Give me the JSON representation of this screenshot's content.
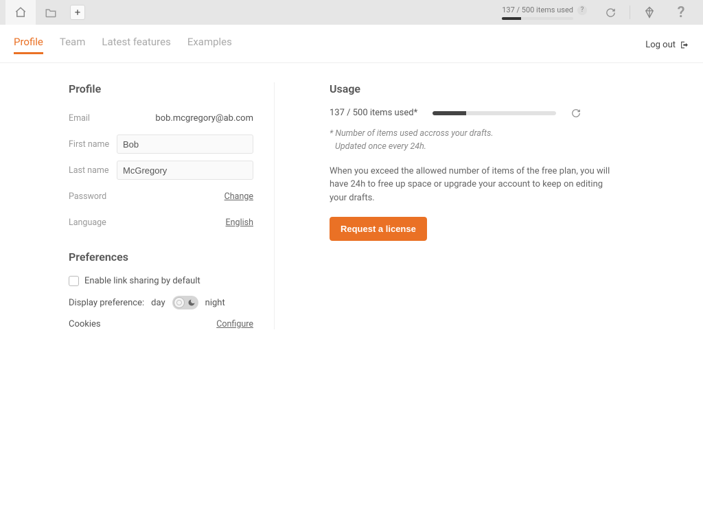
{
  "toolbar": {
    "usage_label": "137 / 500 items used",
    "usage_pct": 27
  },
  "nav": {
    "tabs": [
      "Profile",
      "Team",
      "Latest features",
      "Examples"
    ],
    "active_index": 0,
    "logout_label": "Log out"
  },
  "profile": {
    "heading": "Profile",
    "email_label": "Email",
    "email_value": "bob.mcgregory@ab.com",
    "firstname_label": "First name",
    "firstname_value": "Bob",
    "lastname_label": "Last name",
    "lastname_value": "McGregory",
    "password_label": "Password",
    "change_label": "Change",
    "language_label": "Language",
    "language_value": "English"
  },
  "preferences": {
    "heading": "Preferences",
    "link_sharing_label": "Enable link sharing by default",
    "display_pref_label": "Display preference:",
    "day_label": "day",
    "night_label": "night",
    "cookies_label": "Cookies",
    "configure_label": "Configure"
  },
  "usage": {
    "heading": "Usage",
    "summary": "137 / 500 items used*",
    "pct": 27,
    "note_lead": "*",
    "note_line1": "Number of items used accross your drafts.",
    "note_line2": "Updated once every 24h.",
    "description": "When you exceed the allowed number of items of the free plan, you will have 24h to free up space or upgrade your account to keep on editing your drafts.",
    "cta_label": "Request a license"
  }
}
